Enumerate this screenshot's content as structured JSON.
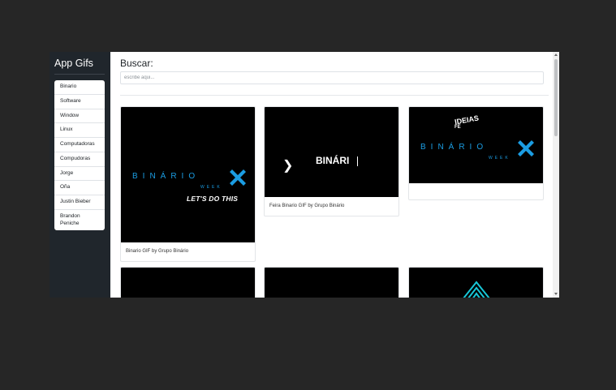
{
  "app": {
    "title": "App Gifs"
  },
  "sidebar": {
    "items": [
      {
        "label": "Binario"
      },
      {
        "label": "Software"
      },
      {
        "label": "Window"
      },
      {
        "label": "Linux"
      },
      {
        "label": "Computadoras"
      },
      {
        "label": "Compudoras"
      },
      {
        "label": "Jorge"
      },
      {
        "label": "Oña"
      },
      {
        "label": "Justin Bieber"
      },
      {
        "label": "Brandon Peniche"
      }
    ]
  },
  "search": {
    "title": "Buscar:",
    "placeholder": "escribe aqui..."
  },
  "gifs": [
    {
      "caption": "Binario GIF by Grupo Binário",
      "brand": "BINÁRIO",
      "week": "WEEK",
      "tagline": "LET'S DO THIS"
    },
    {
      "caption": "Feira Binario GIF by Grupo Binário",
      "brand": "BINÁRI"
    },
    {
      "caption": "",
      "brand": "BINÁRIO",
      "week": "WEEK",
      "top_text": "IDEIAS",
      "small_text": "FE"
    },
    {
      "caption": ""
    },
    {
      "caption": ""
    },
    {
      "caption": ""
    }
  ],
  "icons": {
    "chevron": "chevron-right-icon",
    "cross": "x-cross-icon",
    "triangle": "triangle-logo-icon"
  },
  "colors": {
    "background": "#262626",
    "sidebar": "#20262c",
    "brand_blue": "#1b9de3",
    "accent_teal": "#18c6d6"
  }
}
